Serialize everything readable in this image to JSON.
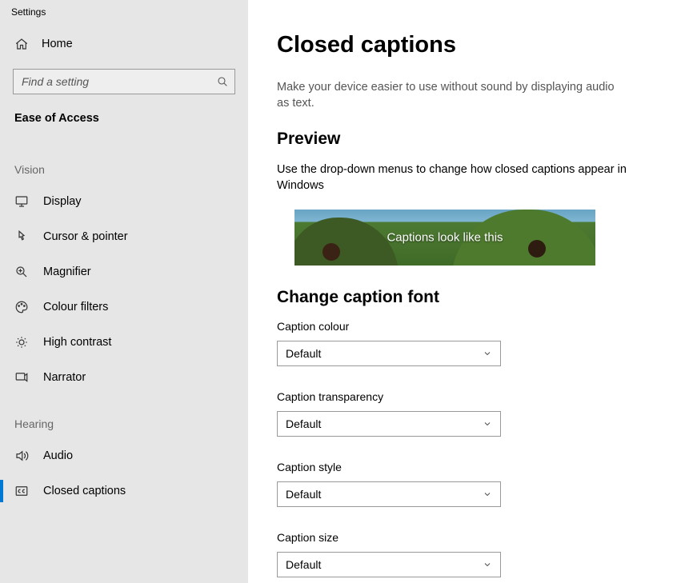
{
  "app_title": "Settings",
  "home_label": "Home",
  "search_placeholder": "Find a setting",
  "category_title": "Ease of Access",
  "sections": {
    "vision_label": "Vision",
    "hearing_label": "Hearing"
  },
  "nav": {
    "display": "Display",
    "cursor": "Cursor & pointer",
    "magnifier": "Magnifier",
    "colour_filters": "Colour filters",
    "high_contrast": "High contrast",
    "narrator": "Narrator",
    "audio": "Audio",
    "closed_captions": "Closed captions"
  },
  "main": {
    "title": "Closed captions",
    "subtitle": "Make your device easier to use without sound by displaying audio as text.",
    "preview_heading": "Preview",
    "preview_desc": "Use the drop-down menus to change how closed captions appear in Windows",
    "preview_caption": "Captions look like this",
    "section_font": "Change caption font",
    "fields": {
      "colour_label": "Caption colour",
      "colour_value": "Default",
      "transparency_label": "Caption transparency",
      "transparency_value": "Default",
      "style_label": "Caption style",
      "style_value": "Default",
      "size_label": "Caption size",
      "size_value": "Default"
    }
  }
}
